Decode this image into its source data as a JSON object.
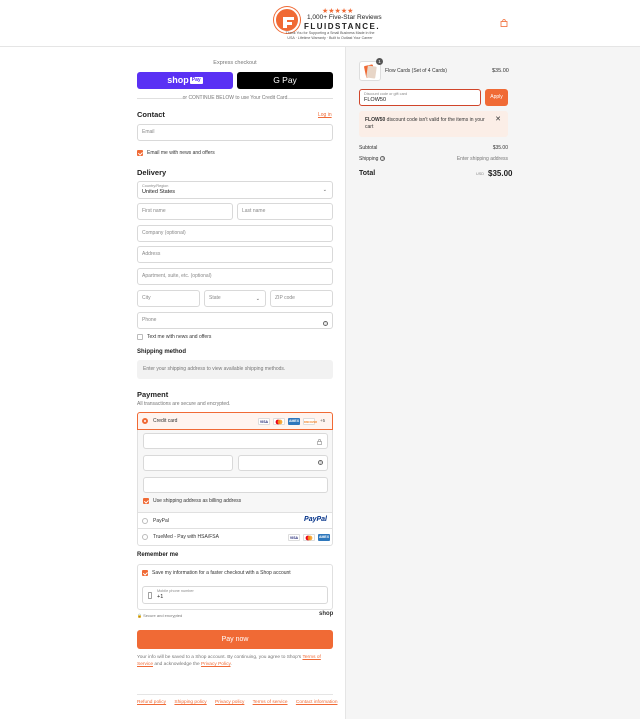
{
  "header": {
    "stars": "★★★★★",
    "reviews": "1,000+ Five-Star Reviews",
    "brand": "FLUIDSTANCE.",
    "tagline": "Thank You for Supporting a Small Business Made in the USA · Lifetime Warranty · Built to Outlast Your Career",
    "accent_color": "#f06a35",
    "icons": {
      "logo": "fluidstance-logo-icon",
      "bag": "shopping-bag-icon"
    }
  },
  "checkout": {
    "express_label": "Express checkout",
    "shop_pay": "shop",
    "shop_pay_badge": "Pay",
    "gpay": "G Pay",
    "or_continue": "or CONTINUE BELOW to use Your Credit Card",
    "contact": {
      "title": "Contact",
      "login": "Log in",
      "email_placeholder": "Email",
      "news_offers": "Email me with news and offers",
      "news_checked": true
    },
    "delivery": {
      "title": "Delivery",
      "country_label": "Country/Region",
      "country_value": "United States",
      "first_name": "First name",
      "last_name": "Last name",
      "company": "Company (optional)",
      "address": "Address",
      "apartment": "Apartment, suite, etc. (optional)",
      "city": "City",
      "state": "State",
      "zip": "ZIP code",
      "phone": "Phone",
      "text_offers": "Text me with news and offers",
      "text_checked": false
    },
    "shipping": {
      "title": "Shipping method",
      "notice": "Enter your shipping address to view available shipping methods."
    },
    "payment": {
      "title": "Payment",
      "subtitle": "All transactions are secure and encrypted.",
      "credit_card": "Credit card",
      "more_cards": "+5",
      "card_logos": [
        "VISA",
        "MC",
        "AMEX",
        "DISCOVER"
      ],
      "billing_same": "Use shipping address as billing address",
      "paypal": "PayPal",
      "paypal_logo": "PayPal",
      "truemed": "TrueMed - Pay with HSA/FSA",
      "truemed_logos": [
        "VISA",
        "MC",
        "AMEX"
      ]
    },
    "remember": {
      "title": "Remember me",
      "save_info": "Save my information for a faster checkout with a Shop account",
      "phone_label": "Mobile phone number",
      "phone_value": "+1",
      "secure": "Secure and encrypted",
      "shop": "shop"
    },
    "pay_now": "Pay now",
    "legal": {
      "prefix": "Your info will be saved to a Shop account. By continuing, you agree to Shop's ",
      "terms": "Terms of Service",
      "middle": " and acknowledge the ",
      "privacy": "Privacy Policy",
      "suffix": "."
    },
    "footer": [
      "Refund policy",
      "Shipping policy",
      "Privacy policy",
      "Terms of service",
      "Contact information"
    ]
  },
  "summary": {
    "qty": "1",
    "product_name": "Flow Cards (Set of 4 Cards)",
    "product_price": "$35.00",
    "discount_label": "Discount code or gift card",
    "discount_value": "FLOW50",
    "apply": "Apply",
    "error_code": "FLOW50",
    "error_text": " discount code isn't valid for the items in your cart",
    "subtotal_label": "Subtotal",
    "subtotal_value": "$35.00",
    "shipping_label": "Shipping",
    "shipping_value": "Enter shipping address",
    "total_label": "Total",
    "currency": "USD",
    "total_value": "$35.00"
  }
}
